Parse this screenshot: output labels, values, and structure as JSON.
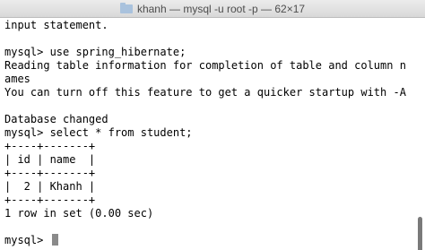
{
  "window": {
    "title": "khanh — mysql -u root -p — 62×17"
  },
  "terminal": {
    "lines": [
      "input statement.",
      "",
      "mysql> use spring_hibernate;",
      "Reading table information for completion of table and column n",
      "ames",
      "You can turn off this feature to get a quicker startup with -A",
      "",
      "Database changed",
      "mysql> select * from student;",
      "+----+-------+",
      "| id | name  |",
      "+----+-------+",
      "|  2 | Khanh |",
      "+----+-------+",
      "1 row in set (0.00 sec)",
      "",
      "mysql> "
    ]
  }
}
